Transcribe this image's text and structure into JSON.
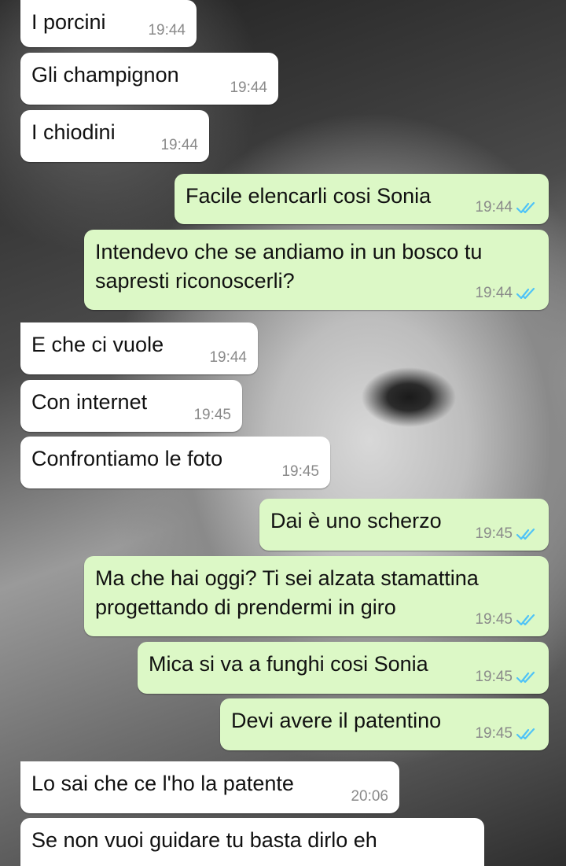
{
  "messages": [
    {
      "direction": "in",
      "text": "I porcini",
      "time": "19:44"
    },
    {
      "direction": "in",
      "text": "Gli champignon",
      "time": "19:44"
    },
    {
      "direction": "in",
      "text": "I chiodini",
      "time": "19:44"
    },
    {
      "direction": "out",
      "text": "Facile elencarli cosi Sonia",
      "time": "19:44",
      "status": "read"
    },
    {
      "direction": "out",
      "text": "Intendevo che se andiamo in un bosco tu\nsapresti riconoscerli?",
      "time": "19:44",
      "status": "read"
    },
    {
      "direction": "in",
      "text": "E che ci vuole",
      "time": "19:44"
    },
    {
      "direction": "in",
      "text": "Con internet",
      "time": "19:45"
    },
    {
      "direction": "in",
      "text": "Confrontiamo le foto",
      "time": "19:45"
    },
    {
      "direction": "out",
      "text": "Dai è uno scherzo",
      "time": "19:45",
      "status": "read"
    },
    {
      "direction": "out",
      "text": "Ma che hai oggi? Ti sei alzata stamattina\nprogettando di prendermi in giro",
      "time": "19:45",
      "status": "read"
    },
    {
      "direction": "out",
      "text": "Mica si va a funghi cosi Sonia",
      "time": "19:45",
      "status": "read"
    },
    {
      "direction": "out",
      "text": "Devi avere il patentino",
      "time": "19:45",
      "status": "read"
    },
    {
      "direction": "in",
      "text": "Lo sai che ce l'ho la patente",
      "time": "20:06"
    },
    {
      "direction": "in",
      "text": "Se non vuoi guidare tu basta dirlo eh",
      "time": ""
    }
  ],
  "colors": {
    "incoming_bubble": "#ffffff",
    "outgoing_bubble": "#dcf8c6",
    "read_ticks": "#4fc3f7",
    "timestamp": "#8a8a8a"
  },
  "icons": {
    "read_status": "double-check-icon"
  }
}
